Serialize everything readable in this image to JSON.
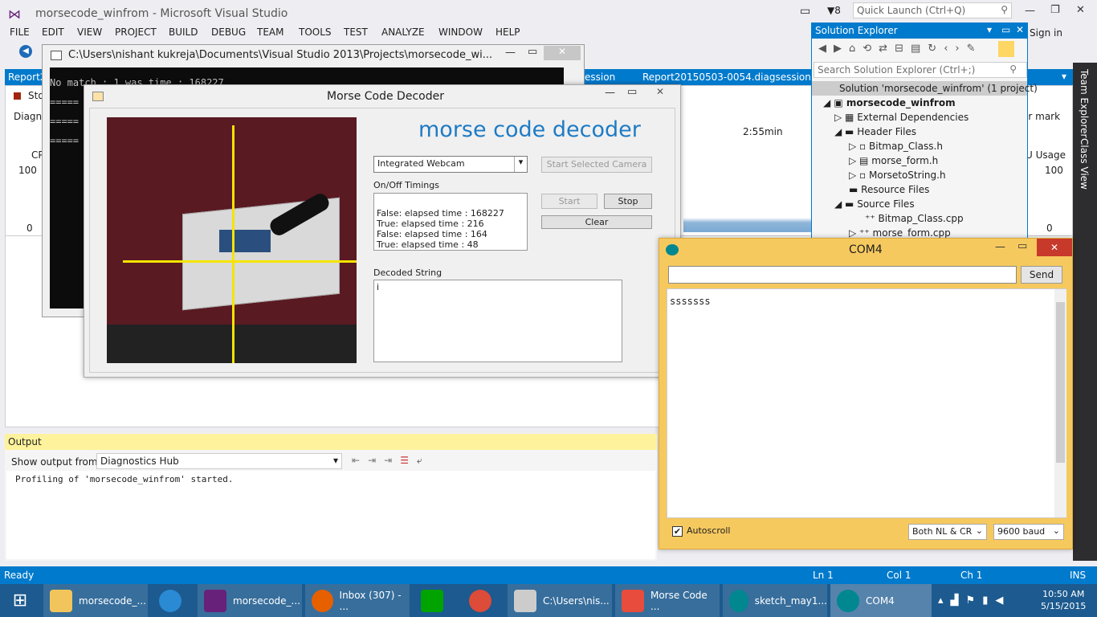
{
  "vs": {
    "title": "morsecode_winfrom - Microsoft Visual Studio",
    "notif_count": "8",
    "quick_launch": "Quick Launch (Ctrl+Q)",
    "sign_in": "Sign in",
    "menu": [
      "FILE",
      "EDIT",
      "VIEW",
      "PROJECT",
      "BUILD",
      "DEBUG",
      "TEAM",
      "TOOLS",
      "TEST",
      "ANALYZE",
      "WINDOW",
      "HELP"
    ],
    "doc_tab_left": "Report2",
    "doc_tab_session": "ession",
    "doc_tab_report": "Report20150503-0054.diagsession",
    "stop_label": "Sto",
    "diag_label": "Diagno",
    "time_label": "2:55min",
    "er_mark": "er mark",
    "cpu_label": "CP",
    "u_usage": "U Usage",
    "y100": "100",
    "y0": "0",
    "right_tabs": [
      "Team Explorer",
      "Class View"
    ]
  },
  "console": {
    "title": "C:\\Users\\nishant kukreja\\Documents\\Visual Studio 2013\\Projects\\morsecode_wi...",
    "lines": [
      "No match : 1 was time : 168227",
      "=====",
      "=====",
      "====="
    ]
  },
  "morse": {
    "title": "Morse Code Decoder",
    "heading": "morse code decoder",
    "camera_select": "Integrated Webcam",
    "start_camera": "Start Selected Camera",
    "timings_label": "On/Off Timings",
    "timings": [
      "False: elapsed time : 168227",
      "True: elapsed time : 216",
      "False: elapsed time : 164",
      "True: elapsed time : 48"
    ],
    "start": "Start",
    "stop": "Stop",
    "clear": "Clear",
    "decoded_label": "Decoded String",
    "decoded_value": "i"
  },
  "com4": {
    "title": "COM4",
    "send": "Send",
    "output": "sssssss",
    "autoscroll": "Autoscroll",
    "line_ending": "Both NL & CR",
    "baud": "9600 baud"
  },
  "solution": {
    "title": "Solution Explorer",
    "search": "Search Solution Explorer (Ctrl+;)",
    "items": [
      "Solution 'morsecode_winfrom' (1 project)",
      "morsecode_winfrom",
      "External Dependencies",
      "Header Files",
      "Bitmap_Class.h",
      "morse_form.h",
      "MorsetoString.h",
      "Resource Files",
      "Source Files",
      "Bitmap_Class.cpp",
      "morse_form.cpp"
    ]
  },
  "output": {
    "title": "Output",
    "show_from": "Show output from:",
    "source": "Diagnostics Hub",
    "text": "Profiling of 'morsecode_winfrom' started."
  },
  "status": {
    "ready": "Ready",
    "ln": "Ln 1",
    "col": "Col 1",
    "ch": "Ch 1",
    "ins": "INS"
  },
  "taskbar": {
    "items": [
      "morsecode_...",
      "",
      "morsecode_...",
      "Inbox (307) - ...",
      "",
      "",
      "C:\\Users\\nis...",
      "Morse Code ...",
      "sketch_may1...",
      "COM4"
    ],
    "time": "10:50 AM",
    "date": "5/15/2015"
  },
  "colors": {
    "accent": "#007acc",
    "com_bg": "#f6c95f",
    "heading": "#1e7bc4"
  }
}
